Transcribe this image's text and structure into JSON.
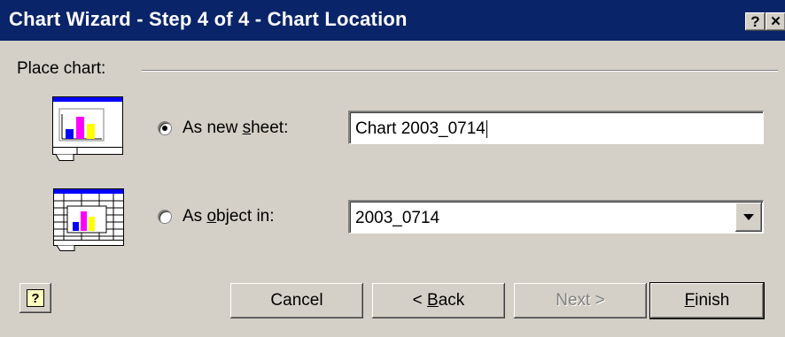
{
  "window": {
    "title": "Chart Wizard - Step 4 of 4 - Chart Location",
    "help_glyph": "?",
    "close_glyph": "✕"
  },
  "group": {
    "label": "Place chart:"
  },
  "options": [
    {
      "label_before": "As new ",
      "label_underlined": "s",
      "label_after": "heet:",
      "selected": true,
      "value": "Chart 2003_0714",
      "icon": "chart-sheet-icon"
    },
    {
      "label_before": "As ",
      "label_underlined": "o",
      "label_after": "bject in:",
      "selected": false,
      "value": "2003_0714",
      "icon": "embedded-chart-icon"
    }
  ],
  "buttons": {
    "help_glyph": "?",
    "cancel": "Cancel",
    "back_prefix": "< ",
    "back_underlined": "B",
    "back_rest": "ack",
    "next": "Next >",
    "finish_underlined": "F",
    "finish_rest": "inish"
  },
  "colors": {
    "titlebar": "#0a246a",
    "face": "#d4d0c8",
    "chart_bar_blue": "#0000ff",
    "chart_bar_magenta": "#ff00ff",
    "chart_bar_yellow": "#ffff00"
  }
}
